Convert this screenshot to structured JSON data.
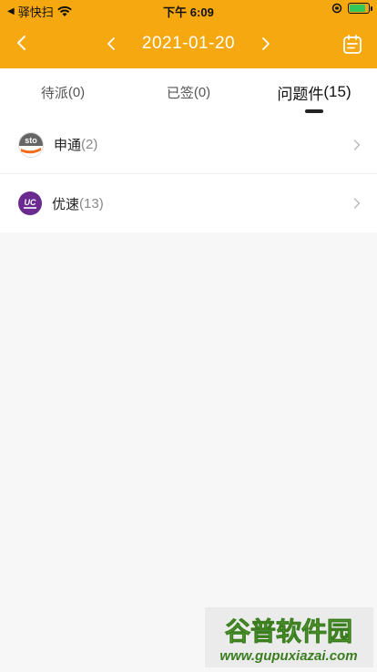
{
  "status_bar": {
    "carrier": "驿快扫",
    "time": "下午 6:09"
  },
  "nav": {
    "date": "2021-01-20",
    "back_icon": "chevron-left-icon",
    "prev_icon": "chevron-left-icon",
    "next_icon": "chevron-right-icon",
    "calendar_icon": "clipboard-icon"
  },
  "tabs": [
    {
      "label": "待派",
      "count": "(0)"
    },
    {
      "label": "已签",
      "count": "(0)"
    },
    {
      "label": "问题件",
      "count": "(15)"
    }
  ],
  "couriers": [
    {
      "name": "申通",
      "count": "(2)",
      "logo_text": "sto"
    },
    {
      "name": "优速",
      "count": "(13)",
      "logo_text": "UC"
    }
  ],
  "watermark": {
    "title": "谷普软件园",
    "url": "www.gupuxiazai.com"
  },
  "colors": {
    "header": "#f5a80f",
    "battery": "#34c759",
    "sto_orange": "#f26a1b",
    "uc_purple": "#6a2a8f"
  }
}
